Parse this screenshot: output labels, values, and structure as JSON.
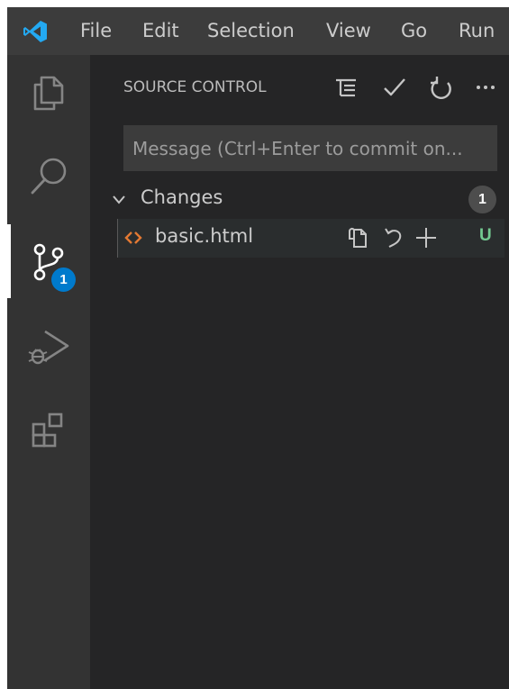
{
  "app": {
    "logo": "vscode-logo-icon",
    "brand_color": "#23a9f2"
  },
  "menubar": {
    "items": [
      "File",
      "Edit",
      "Selection",
      "View",
      "Go",
      "Run"
    ]
  },
  "activity_bar": {
    "items": [
      {
        "icon": "explorer-icon",
        "active": false
      },
      {
        "icon": "search-icon",
        "active": false
      },
      {
        "icon": "source-control-icon",
        "active": true,
        "badge": "1"
      },
      {
        "icon": "run-debug-icon",
        "active": false
      },
      {
        "icon": "extensions-icon",
        "active": false
      }
    ],
    "badge_color": "#007acc"
  },
  "source_control": {
    "title": "SOURCE CONTROL",
    "toolbar": [
      "view-as-tree-icon",
      "commit-check-icon",
      "refresh-icon",
      "more-actions-icon"
    ],
    "message_placeholder": "Message (Ctrl+Enter to commit on...",
    "changes": {
      "label": "Changes",
      "count": "1",
      "files": [
        {
          "name": "basic.html",
          "icon": "html-file-icon",
          "actions": [
            "open-file-icon",
            "discard-changes-icon",
            "stage-changes-icon"
          ],
          "status": "U",
          "status_color": "#73c991"
        }
      ]
    }
  }
}
